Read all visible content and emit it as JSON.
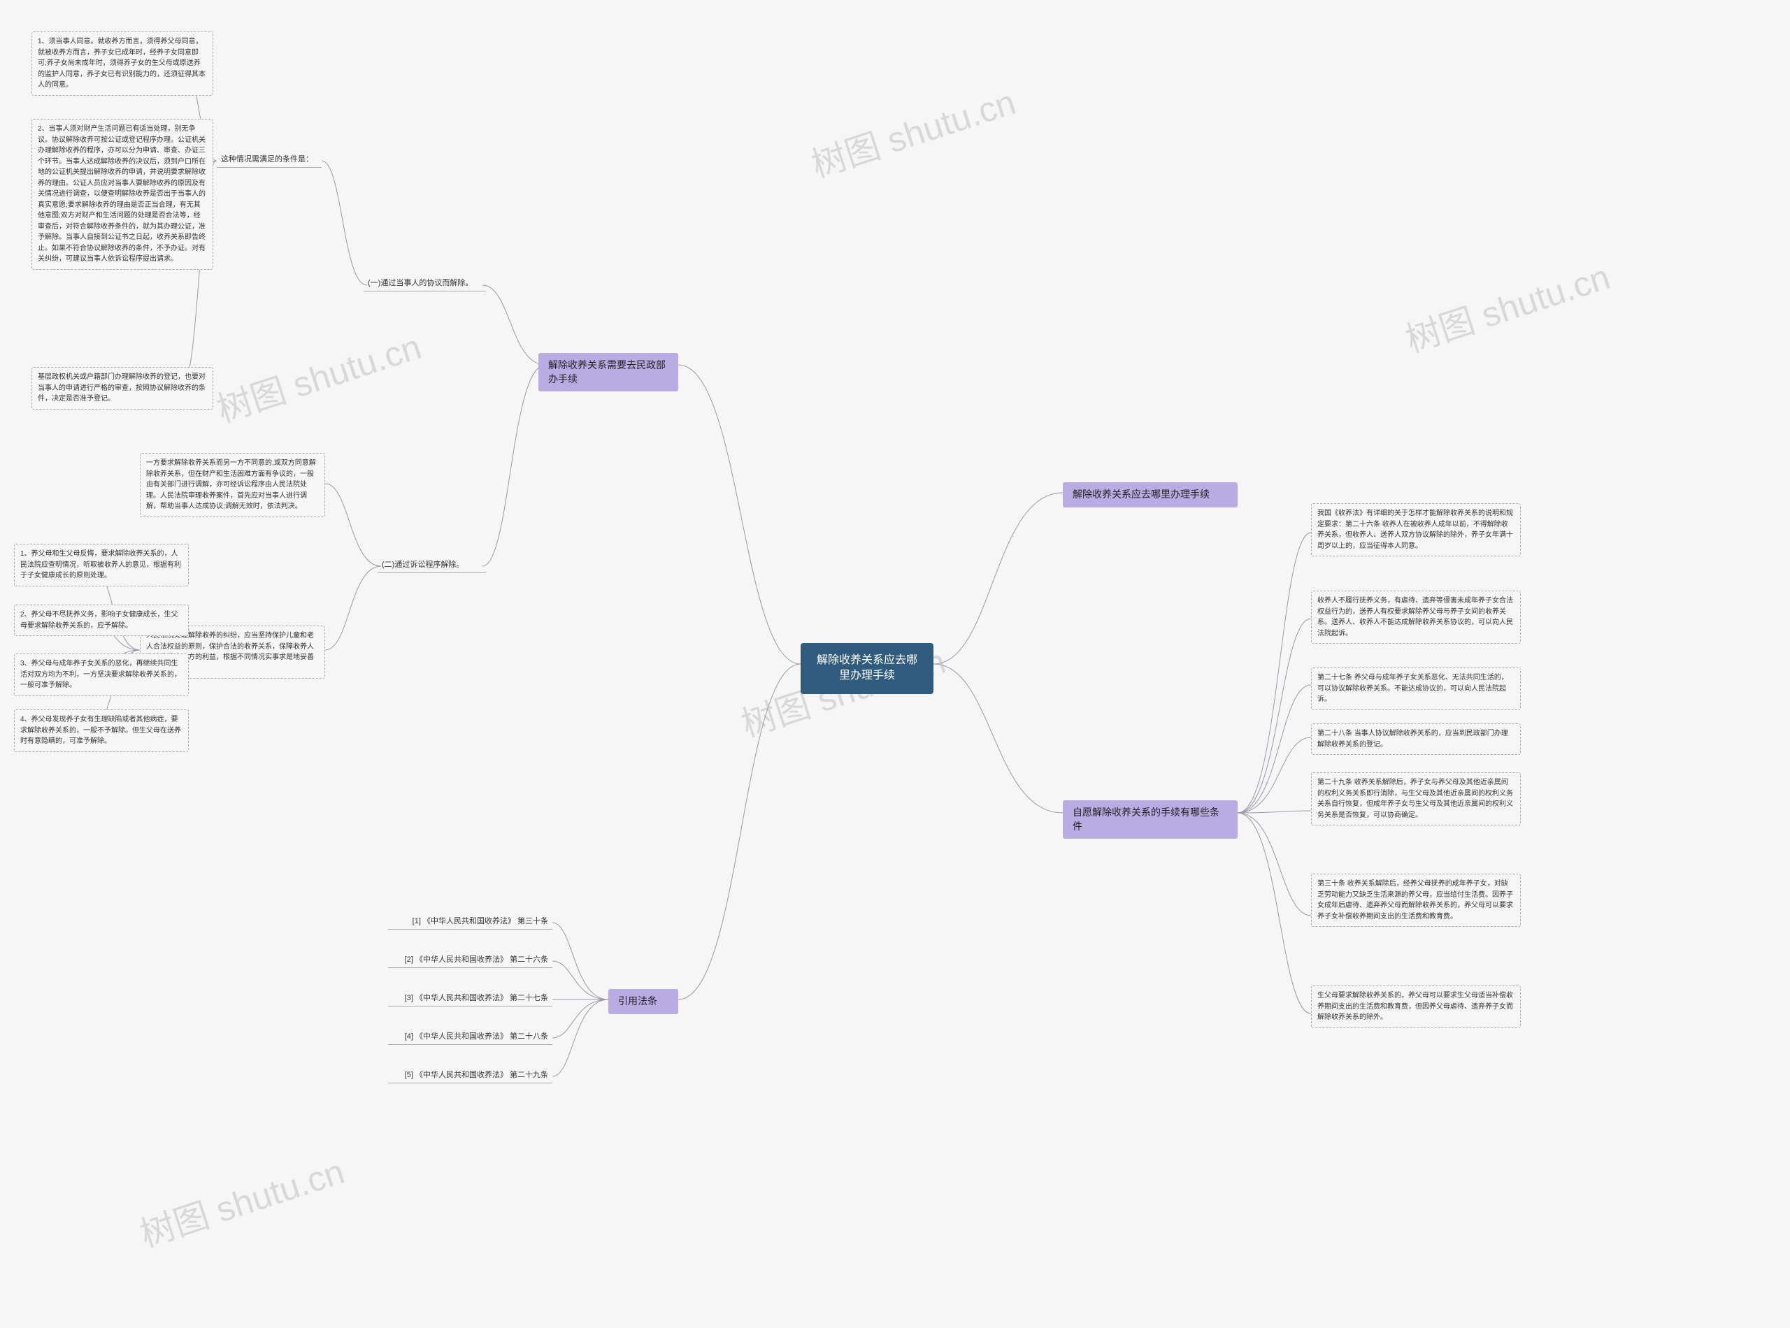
{
  "watermark_text": "树图 shutu.cn",
  "center": {
    "title": "解除收养关系应去哪里办理手续"
  },
  "right_branches": {
    "b1": {
      "label": "解除收养关系应去哪里办理手续"
    },
    "b2": {
      "label": "自愿解除收养关系的手续有哪些条件"
    }
  },
  "right_details": {
    "d1": "我国《收养法》有详细的关于怎样才能解除收养关系的说明和规定要求：第二十六条 收养人在被收养人成年以前，不得解除收养关系，但收养人、送养人双方协议解除的除外，养子女年满十周岁以上的，应当征得本人同意。",
    "d2": "收养人不履行抚养义务，有虐待、遗弃等侵害未成年养子女合法权益行为的，送养人有权要求解除养父母与养子女间的收养关系。送养人、收养人不能达成解除收养关系协议的，可以向人民法院起诉。",
    "d3": "第二十七条 养父母与成年养子女关系恶化、无法共同生活的，可以协议解除收养关系。不能达成协议的，可以向人民法院起诉。",
    "d4": "第二十八条 当事人协议解除收养关系的，应当到民政部门办理解除收养关系的登记。",
    "d5": "第二十九条 收养关系解除后，养子女与养父母及其他近亲属间的权利义务关系即行消除，与生父母及其他近亲属间的权利义务关系自行恢复，但成年养子女与生父母及其他近亲属间的权利义务关系是否恢复，可以协商确定。",
    "d6": "第三十条 收养关系解除后，经养父母抚养的成年养子女，对缺乏劳动能力又缺乏生活来源的养父母，应当给付生活费。因养子女成年后虐待、遗弃养父母而解除收养关系的，养父母可以要求养子女补偿收养期间支出的生活费和教育费。",
    "d7": "生父母要求解除收养关系的，养父母可以要求生父母适当补偿收养期间支出的生活费和教育费，但因养父母虐待、遗弃养子女而解除收养关系的除外。"
  },
  "left_branches": {
    "b3": {
      "label": "解除收养关系需要去民政部办手续"
    },
    "b4": {
      "label": "引用法条"
    }
  },
  "left_mid": {
    "m1": "(一)通过当事人的协议而解除。",
    "m2": "(二)通过诉讼程序解除。"
  },
  "left_conditions": {
    "header": "这种情况需满足的条件是：",
    "c1": "1、须当事人同意。就收养方而言，须得养父母同意，就被收养方而言，养子女已成年时，经养子女同意即可;养子女尚未成年时，须得养子女的生父母或原送养的监护人同意，养子女已有识别能力的，还须征得其本人的同意。",
    "c2": "2、当事人须对财产生活问题已有适当处理，别无争议。协议解除收养可按公证或登记程序办理。公证机关办理解除收养的程序，亦可以分为申请、审查、办证三个环节。当事人达成解除收养的决议后，须到户口所在地的公证机关提出解除收养的申请，并说明要求解除收养的理由。公证人员应对当事人要解除收养的原因及有关情况进行调查，以便查明解除收养是否出于当事人的真实意愿;要求解除收养的理由是否正当合理，有无其他意图;双方对财产和生活问题的处理是否合法等，经审查后，对符合解除收养条件的，就为其办理公证，准予解除。当事人自接到公证书之日起，收养关系即告终止。如果不符合协议解除收养的条件，不予办证。对有关纠纷，可建议当事人依诉讼程序提出请求。",
    "c3": "基层政权机关或户籍部门办理解除收养的登记，也要对当事人的申请进行严格的审查，按照协议解除收养的条件，决定是否准予登记。"
  },
  "left_litigation": {
    "lit1": "一方要求解除收养关系而另一方不同意的,或双方同意解除收养关系，但在财产和生活困难方面有争议的，一般由有关部门进行调解，亦可经诉讼程序由人民法院处理。人民法院审理收养案件，首先应对当事人进行调解，帮助当事人达成协议;调解无效时，依法判决。",
    "lit2": "人民法院处理解除收养的纠纷，应当坚持保护儿童和老人合法权益的原则，保护合法的收养关系，保障收养人和被收养人双方的利益，根据不同情况实事求是地妥善解决：",
    "p1": "1、养父母和生父母反悔，要求解除收养关系的，人民法院应查明情况，听取被收养人的意见，根据有利于子女健康成长的原则处理。",
    "p2": "2、养父母不尽抚养义务，影响子女健康成长，生父母要求解除收养关系的，应予解除。",
    "p3": "3、养父母与成年养子女关系的恶化，再继续共同生活对双方均为不利，一方坚决要求解除收养关系的，一般可准予解除。",
    "p4": "4、养父母发现养子女有生理缺陷或者其他病症，要求解除收养关系的，一般不予解除。但生父母在送养时有意隐瞒的，可准予解除。"
  },
  "law_refs": {
    "r1": "[1] 《中华人民共和国收养法》 第三十条",
    "r2": "[2] 《中华人民共和国收养法》 第二十六条",
    "r3": "[3] 《中华人民共和国收养法》 第二十七条",
    "r4": "[4] 《中华人民共和国收养法》 第二十八条",
    "r5": "[5] 《中华人民共和国收养法》 第二十九条"
  },
  "chart_data": {
    "type": "table",
    "title": "解除收养关系应去哪里办理手续",
    "structure": "mind-map",
    "root": "解除收养关系应去哪里办理手续",
    "branches": [
      {
        "side": "right",
        "label": "解除收养关系应去哪里办理手续",
        "children": []
      },
      {
        "side": "right",
        "label": "自愿解除收养关系的手续有哪些条件",
        "children": [
          "我国《收养法》有详细的关于怎样才能解除收养关系的说明和规定要求：第二十六条 …",
          "收养人不履行抚养义务 …",
          "第二十七条 …",
          "第二十八条 …",
          "第二十九条 …",
          "第三十条 …",
          "生父母要求解除收养关系的 …"
        ]
      },
      {
        "side": "left",
        "label": "解除收养关系需要去民政部办手续",
        "children": [
          {
            "label": "(一)通过当事人的协议而解除。",
            "children": [
              "这种情况需满足的条件是：",
              "1、须当事人同意 …",
              "2、当事人须对财产生活问题已有适当处理 …",
              "基层政权机关或户籍部门办理解除收养的登记 …"
            ]
          },
          {
            "label": "(二)通过诉讼程序解除。",
            "children": [
              "一方要求解除收养关系而另一方不同意的 …",
              "人民法院处理解除收养的纠纷 …",
              "1、养父母和生父母反悔 …",
              "2、养父母不尽抚养义务 …",
              "3、养父母与成年养子女关系的恶化 …",
              "4、养父母发现养子女有生理缺陷 …"
            ]
          }
        ]
      },
      {
        "side": "left",
        "label": "引用法条",
        "children": [
          "[1] 《中华人民共和国收养法》 第三十条",
          "[2] 《中华人民共和国收养法》 第二十六条",
          "[3] 《中华人民共和国收养法》 第二十七条",
          "[4] 《中华人民共和国收养法》 第二十八条",
          "[5] 《中华人民共和国收养法》 第二十九条"
        ]
      }
    ]
  }
}
